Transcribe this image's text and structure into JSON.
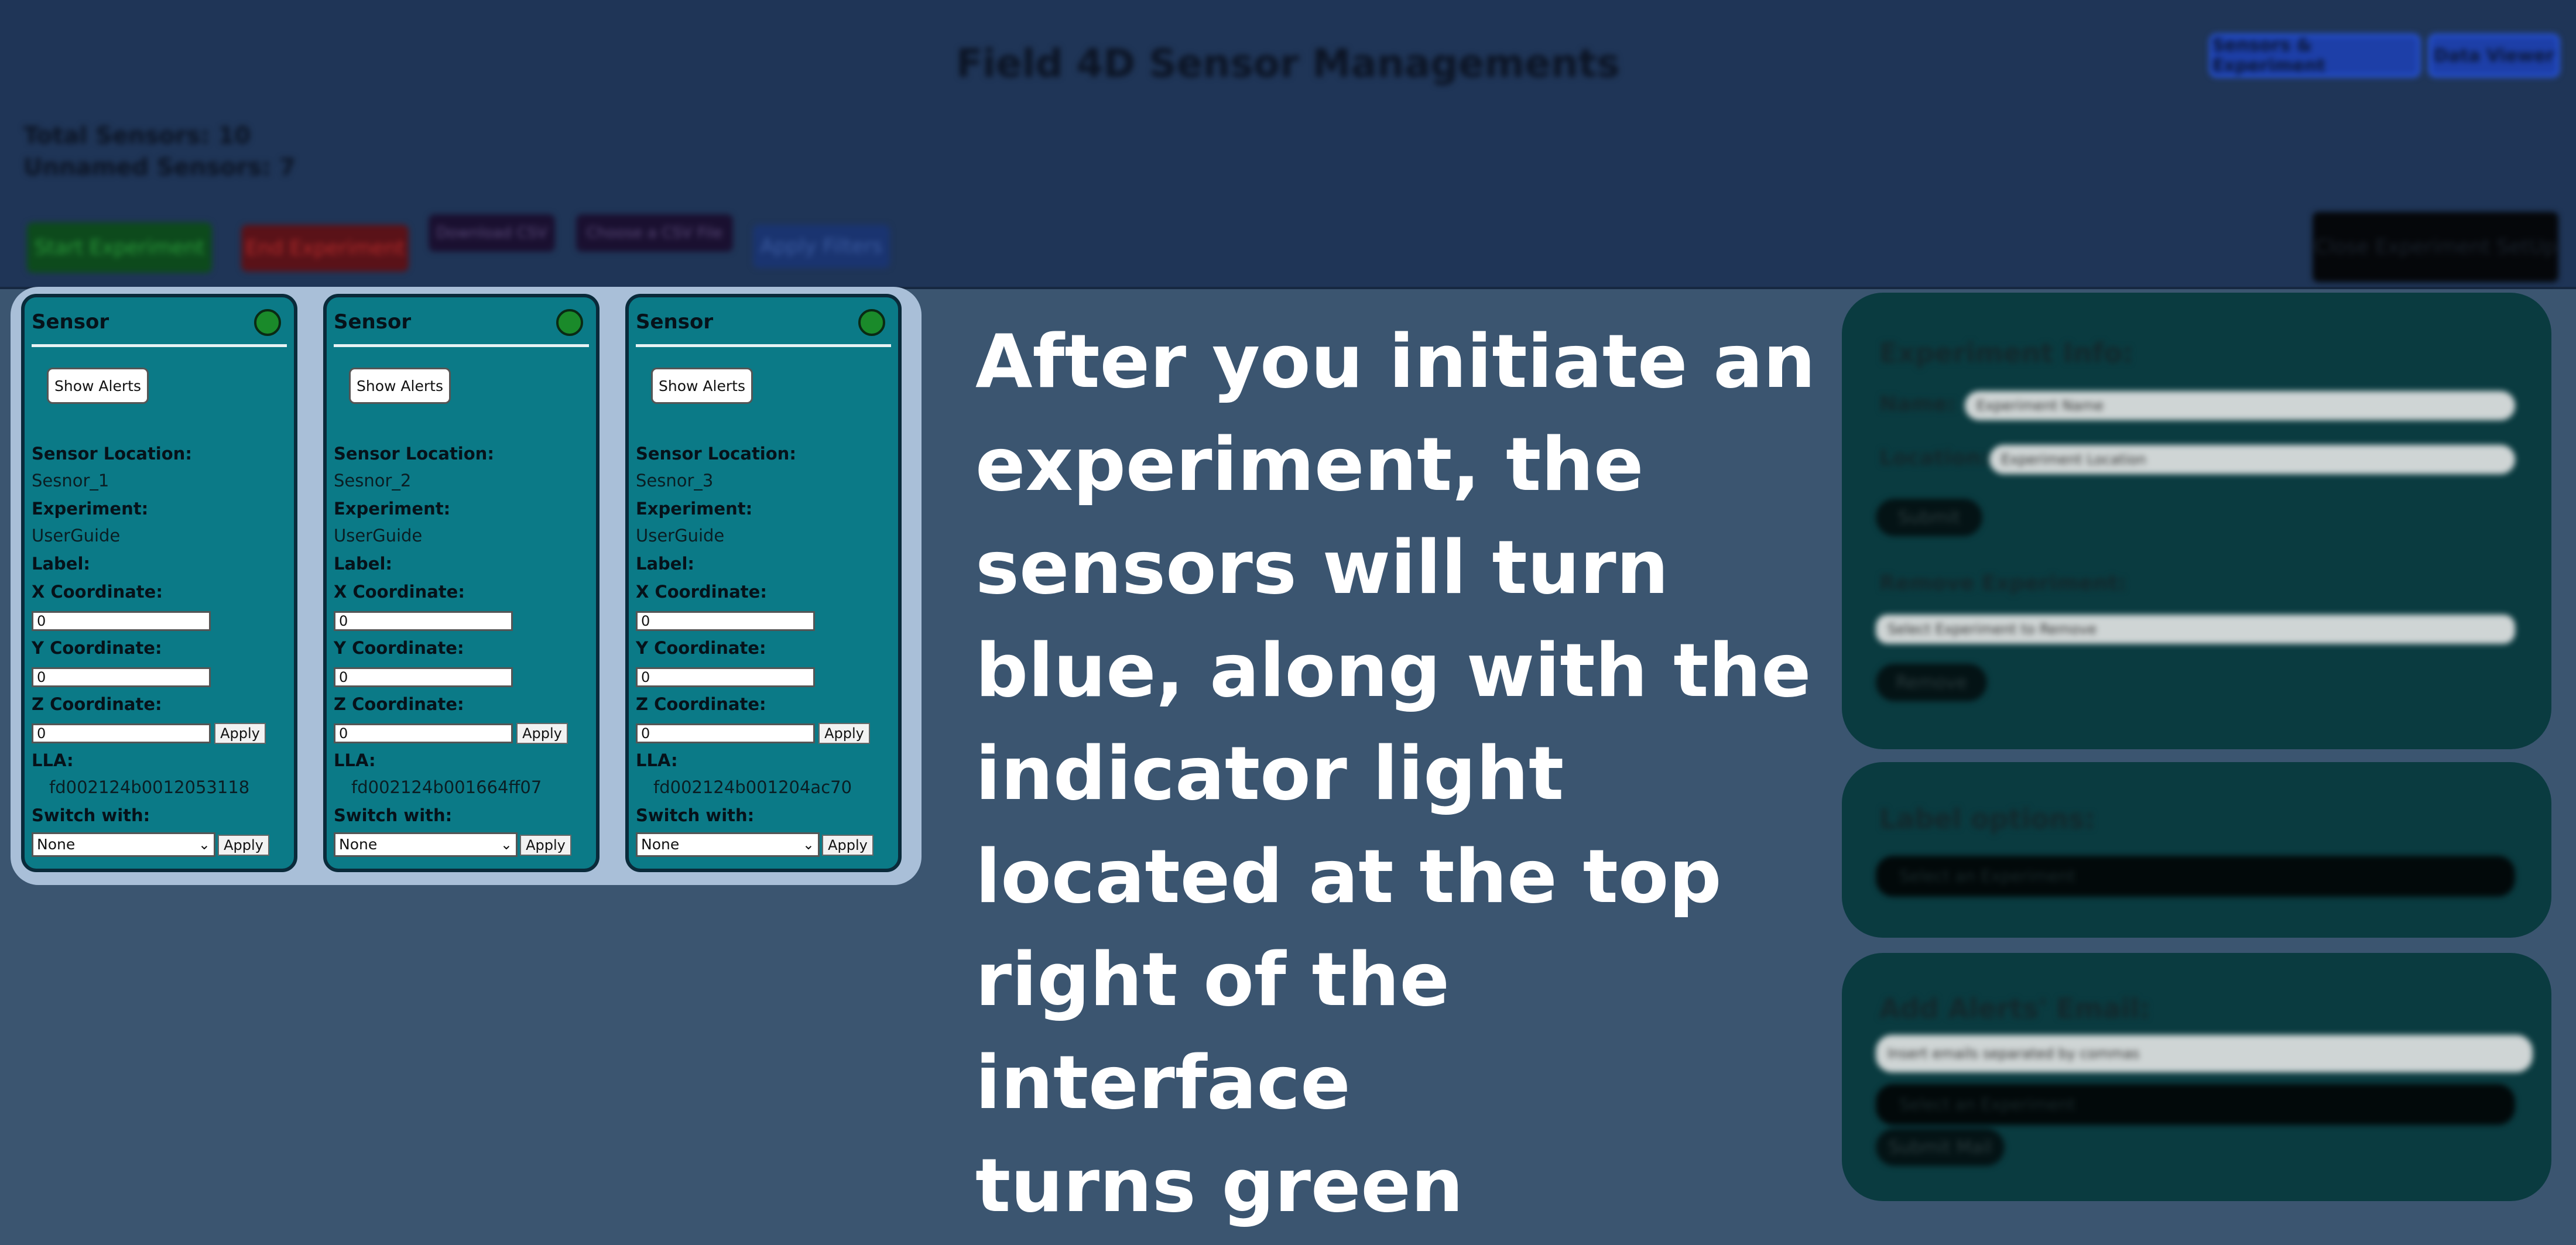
{
  "header": {
    "title": "Field 4D Sensor Managements",
    "total_sensors": "Total Sensors: 10",
    "unnamed_sensors": "Unnamed Sensors: 7",
    "nav": [
      "Sensors & Experiment",
      "Data Viewer"
    ]
  },
  "toolbar": {
    "start": "Start Experiment",
    "end": "End Experiment",
    "download": "Download CSV",
    "choose": "Choose a CSV File",
    "filters": "Apply Filters",
    "close_setup": "Close Experiment SetUp"
  },
  "sensor_common": {
    "title": "Sensor",
    "show_alerts": "Show Alerts",
    "location_label": "Sensor Location:",
    "experiment_label": "Experiment:",
    "label_label": "Label:",
    "x_label": "X Coordinate:",
    "y_label": "Y Coordinate:",
    "z_label": "Z Coordinate:",
    "lla_label": "LLA:",
    "switch_label": "Switch with:",
    "apply": "Apply",
    "status_color": "#1a8a2a"
  },
  "sensors": [
    {
      "location": "Sesnor_1",
      "experiment": "UserGuide",
      "x": "0",
      "y": "0",
      "z": "0",
      "lla": "fd002124b0012053118",
      "switch_with": "None"
    },
    {
      "location": "Sesnor_2",
      "experiment": "UserGuide",
      "x": "0",
      "y": "0",
      "z": "0",
      "lla": "fd002124b001664ff07",
      "switch_with": "None"
    },
    {
      "location": "Sesnor_3",
      "experiment": "UserGuide",
      "x": "0",
      "y": "0",
      "z": "0",
      "lla": "fd002124b001204ac70",
      "switch_with": "None"
    }
  ],
  "instructions": {
    "lines": [
      "After you initiate an",
      "experiment, the",
      "sensors will turn",
      "blue, along with the",
      "indicator light",
      "located at the top",
      "right of the interface",
      "turns green"
    ]
  },
  "experiment_info": {
    "title": "Experiment Info:",
    "name_label": "Name:",
    "name_placeholder": "Experiment Name",
    "location_label": "Location:",
    "location_placeholder": "Experiment Location",
    "submit": "Submit",
    "remove_label": "Remove Experiment:",
    "remove_select": "Select Experiment to Remove",
    "remove": "Remove"
  },
  "label_options": {
    "title": "Label options:",
    "select": "Select an Experiment"
  },
  "alerts_email": {
    "title": "Add Alerts' Email:",
    "email_placeholder": "Insert emails separated by commas",
    "select": "Select an Experiment",
    "submit": "Submit Mail"
  }
}
